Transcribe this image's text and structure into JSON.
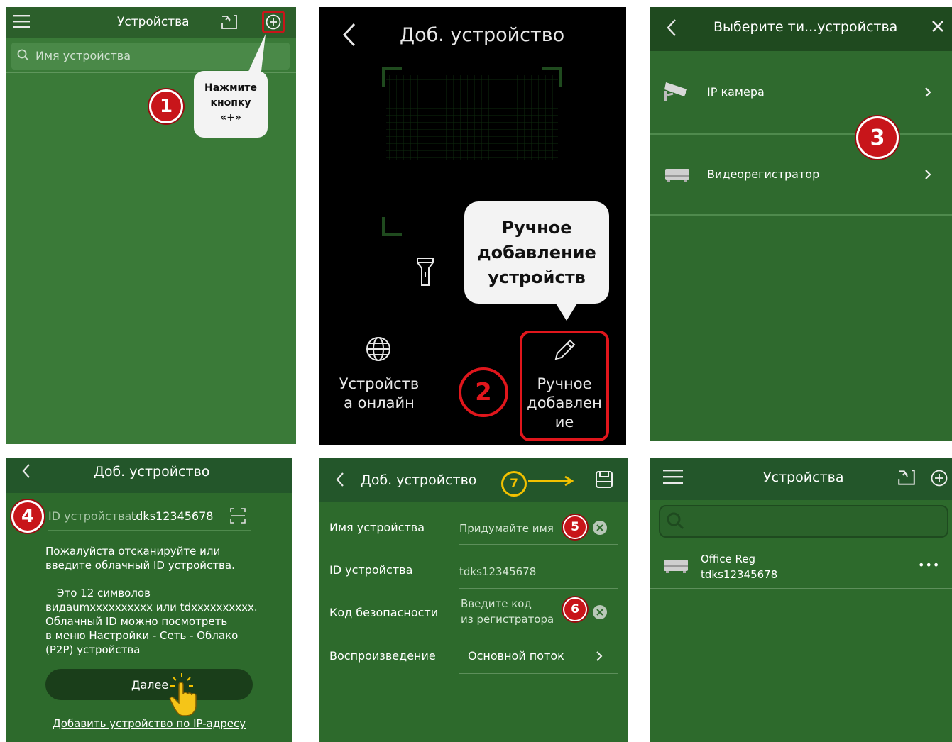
{
  "panel1": {
    "title": "Устройства",
    "search_placeholder": "Имя устройства",
    "step": "1",
    "tooltip_line1": "Нажмите",
    "tooltip_line2": "кнопку",
    "tooltip_line3": "«+»"
  },
  "panel2": {
    "title": "Доб. устройство",
    "callout_line1": "Ручное",
    "callout_line2": "добавление",
    "callout_line3": "устройств",
    "online_line1": "Устройств",
    "online_line2": "а онлайн",
    "manual_line1": "Ручное",
    "manual_line2": "добавлен",
    "manual_line3": "ие",
    "step": "2"
  },
  "panel3": {
    "title": "Выберите ти...устройства",
    "items": [
      {
        "label": "IP камера"
      },
      {
        "label": "Видеорегистратор"
      }
    ],
    "step": "3"
  },
  "panel4": {
    "title": "Доб. устройство",
    "id_label": "ID устройства",
    "id_value": "tdks12345678",
    "hint1_line1": "Пожалуйста отсканируйте или",
    "hint1_line2": "введите облачный ID устройства.",
    "hint2_line1": "Это 12 символов",
    "hint2_line2": "видаumxxxxxxxxxx или tdxxxxxxxxxx.",
    "hint2_line3": "Облачный ID можно посмотреть",
    "hint2_line4": "в меню Настройки - Сеть - Облако",
    "hint2_line5": "(P2P) устройства",
    "next_button": "Далее",
    "ip_link": "Добавить устройство по IP-адресу",
    "step": "4"
  },
  "panel5": {
    "title": "Доб. устройство",
    "rows": [
      {
        "label": "Имя устройства",
        "value": "Придумайте имя"
      },
      {
        "label": "ID устройства",
        "value": "tdks12345678"
      },
      {
        "label": "Код безопасности",
        "value_line1": "Введите код",
        "value_line2": "из регистратора"
      },
      {
        "label": "Воспроизведение",
        "value": "Основной поток"
      }
    ],
    "step5": "5",
    "step6": "6",
    "step7": "7"
  },
  "panel6": {
    "title": "Устройства",
    "device_name": "Office Reg",
    "device_id": "tdks12345678",
    "more": "•••"
  },
  "colors": {
    "app_green": "#3a7a38",
    "header_green": "#2c5f2b",
    "badge_red": "#c8151a",
    "arrow_yellow": "#f2c100"
  }
}
